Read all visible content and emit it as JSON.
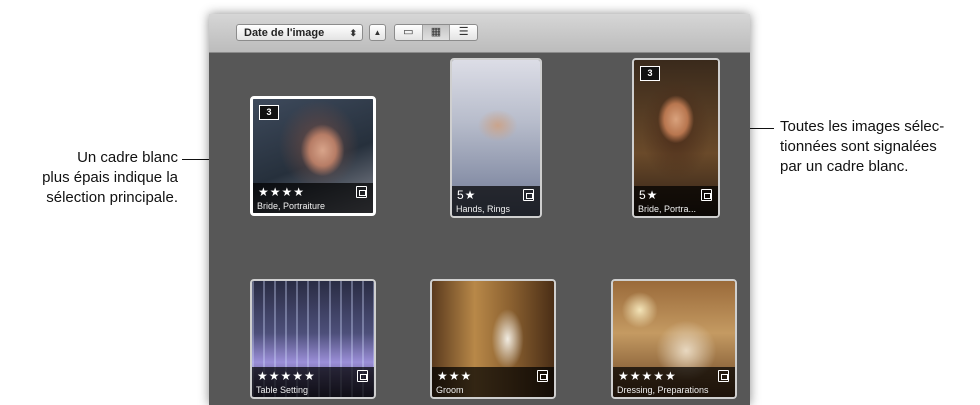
{
  "callouts": {
    "left": [
      "Un cadre blanc",
      "plus épais indique la",
      "sélection principale."
    ],
    "right": [
      "Toutes les images sélec-",
      "tionnées sont signalées",
      "par un cadre blanc."
    ]
  },
  "toolbar": {
    "sort_label": "Date de l'image",
    "sort_arrows": "⬍",
    "sort_direction": "▲",
    "views": [
      "▭",
      "▦",
      "☰"
    ]
  },
  "thumbnails": [
    {
      "stack_count": "3",
      "rating": "★★★★",
      "caption": "Bride, Portraiture",
      "primary": true
    },
    {
      "stack_count": "",
      "rating": "5★",
      "caption": "Hands, Rings",
      "primary": false
    },
    {
      "stack_count": "3",
      "rating": "5★",
      "caption": "Bride, Portra...",
      "primary": false
    },
    {
      "stack_count": "",
      "rating": "★★★★★",
      "caption": "Table Setting",
      "primary": false
    },
    {
      "stack_count": "",
      "rating": "★★★",
      "caption": "Groom",
      "primary": false
    },
    {
      "stack_count": "",
      "rating": "★★★★★",
      "caption": "Dressing, Preparations",
      "primary": false
    }
  ],
  "colors": {
    "panel_bg": "#575757",
    "selection_border": "#ffffff"
  }
}
